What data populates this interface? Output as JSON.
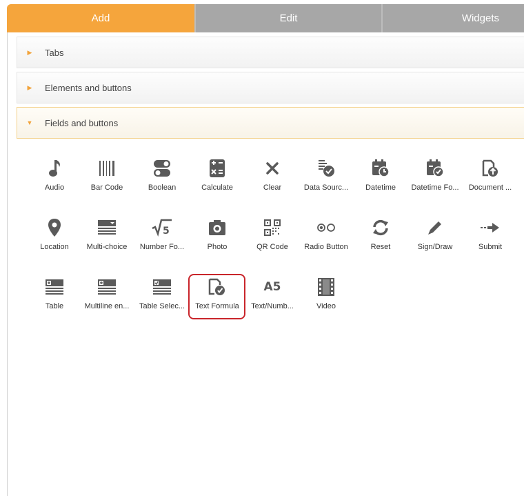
{
  "tabs": [
    {
      "label": "Add",
      "active": true
    },
    {
      "label": "Edit",
      "active": false
    },
    {
      "label": "Widgets",
      "active": false
    }
  ],
  "accordion": [
    {
      "label": "Tabs",
      "expanded": false
    },
    {
      "label": "Elements and buttons",
      "expanded": false
    },
    {
      "label": "Fields and buttons",
      "expanded": true
    }
  ],
  "fields": [
    {
      "label": "Audio",
      "icon": "music-note-icon"
    },
    {
      "label": "Bar Code",
      "icon": "barcode-icon"
    },
    {
      "label": "Boolean",
      "icon": "toggle-icon"
    },
    {
      "label": "Calculate",
      "icon": "calculator-icon"
    },
    {
      "label": "Clear",
      "icon": "clear-x-icon"
    },
    {
      "label": "Data Sourc...",
      "icon": "data-source-icon"
    },
    {
      "label": "Datetime",
      "icon": "calendar-clock-icon"
    },
    {
      "label": "Datetime Fo...",
      "icon": "calendar-formula-icon"
    },
    {
      "label": "Document ...",
      "icon": "document-upload-icon"
    },
    {
      "label": "Location",
      "icon": "map-pin-icon"
    },
    {
      "label": "Multi-choice",
      "icon": "multi-choice-icon"
    },
    {
      "label": "Number Fo...",
      "icon": "sqrt-icon"
    },
    {
      "label": "Photo",
      "icon": "camera-icon"
    },
    {
      "label": "QR Code",
      "icon": "qr-code-icon"
    },
    {
      "label": "Radio Button",
      "icon": "radio-icon"
    },
    {
      "label": "Reset",
      "icon": "reset-icon"
    },
    {
      "label": "Sign/Draw",
      "icon": "pen-icon"
    },
    {
      "label": "Submit",
      "icon": "submit-arrow-icon"
    },
    {
      "label": "Table",
      "icon": "table-icon"
    },
    {
      "label": "Multiline en...",
      "icon": "multiline-entry-icon"
    },
    {
      "label": "Table Selec...",
      "icon": "table-select-icon"
    },
    {
      "label": "Text Formula",
      "icon": "text-formula-icon"
    },
    {
      "label": "Text/Numb...",
      "icon": "text-number-icon",
      "glyph": "A5"
    },
    {
      "label": "Video",
      "icon": "film-icon"
    }
  ],
  "colors": {
    "accent": "#f5a53c",
    "inactive_tab": "#a7a7a7",
    "icon": "#5a5a5a",
    "highlight": "#c9252b"
  }
}
